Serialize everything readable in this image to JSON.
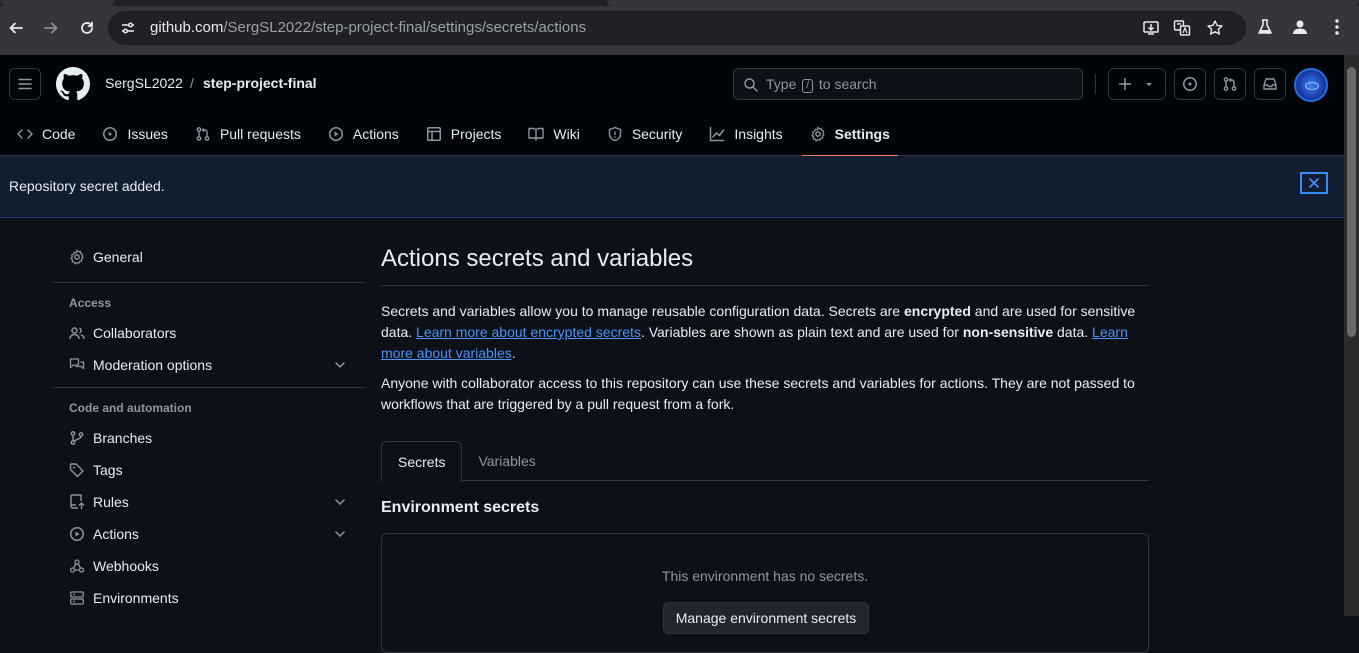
{
  "browser": {
    "url_host": "github.com",
    "url_path": "/SergSL2022/step-project-final/settings/secrets/actions"
  },
  "header": {
    "owner": "SergSL2022",
    "separator": "/",
    "repo": "step-project-final",
    "search_before": "Type",
    "search_key": "/",
    "search_after": "to search"
  },
  "repo_nav": {
    "items": [
      {
        "label": "Code",
        "icon": "code-icon"
      },
      {
        "label": "Issues",
        "icon": "issue-opened-icon"
      },
      {
        "label": "Pull requests",
        "icon": "git-pull-request-icon"
      },
      {
        "label": "Actions",
        "icon": "play-icon"
      },
      {
        "label": "Projects",
        "icon": "table-icon"
      },
      {
        "label": "Wiki",
        "icon": "book-icon"
      },
      {
        "label": "Security",
        "icon": "shield-icon"
      },
      {
        "label": "Insights",
        "icon": "graph-icon"
      },
      {
        "label": "Settings",
        "icon": "gear-icon",
        "active": true
      }
    ]
  },
  "flash": {
    "message": "Repository secret added."
  },
  "sidebar": {
    "general": "General",
    "access_heading": "Access",
    "collaborators": "Collaborators",
    "moderation": "Moderation options",
    "code_heading": "Code and automation",
    "branches": "Branches",
    "tags": "Tags",
    "rules": "Rules",
    "actions": "Actions",
    "webhooks": "Webhooks",
    "environments": "Environments"
  },
  "main": {
    "title": "Actions secrets and variables",
    "p1_a": "Secrets and variables allow you to manage reusable configuration data. Secrets are ",
    "p1_b": "encrypted",
    "p1_c": " and are used for sensitive data. ",
    "p1_link1": "Learn more about encrypted secrets",
    "p1_d": ". Variables are shown as plain text and are used for ",
    "p1_e": "non-sensitive",
    "p1_f": " data. ",
    "p1_link2": "Learn more about variables",
    "p1_g": ".",
    "p2": "Anyone with collaborator access to this repository can use these secrets and variables for actions. They are not passed to workflows that are triggered by a pull request from a fork.",
    "tabs": [
      "Secrets",
      "Variables"
    ],
    "env_title": "Environment secrets",
    "env_empty": "This environment has no secrets.",
    "env_button": "Manage environment secrets"
  },
  "colors": {
    "accent_underline": "#f78166",
    "link": "#4493f8",
    "flash_bg": "#121d2f"
  }
}
